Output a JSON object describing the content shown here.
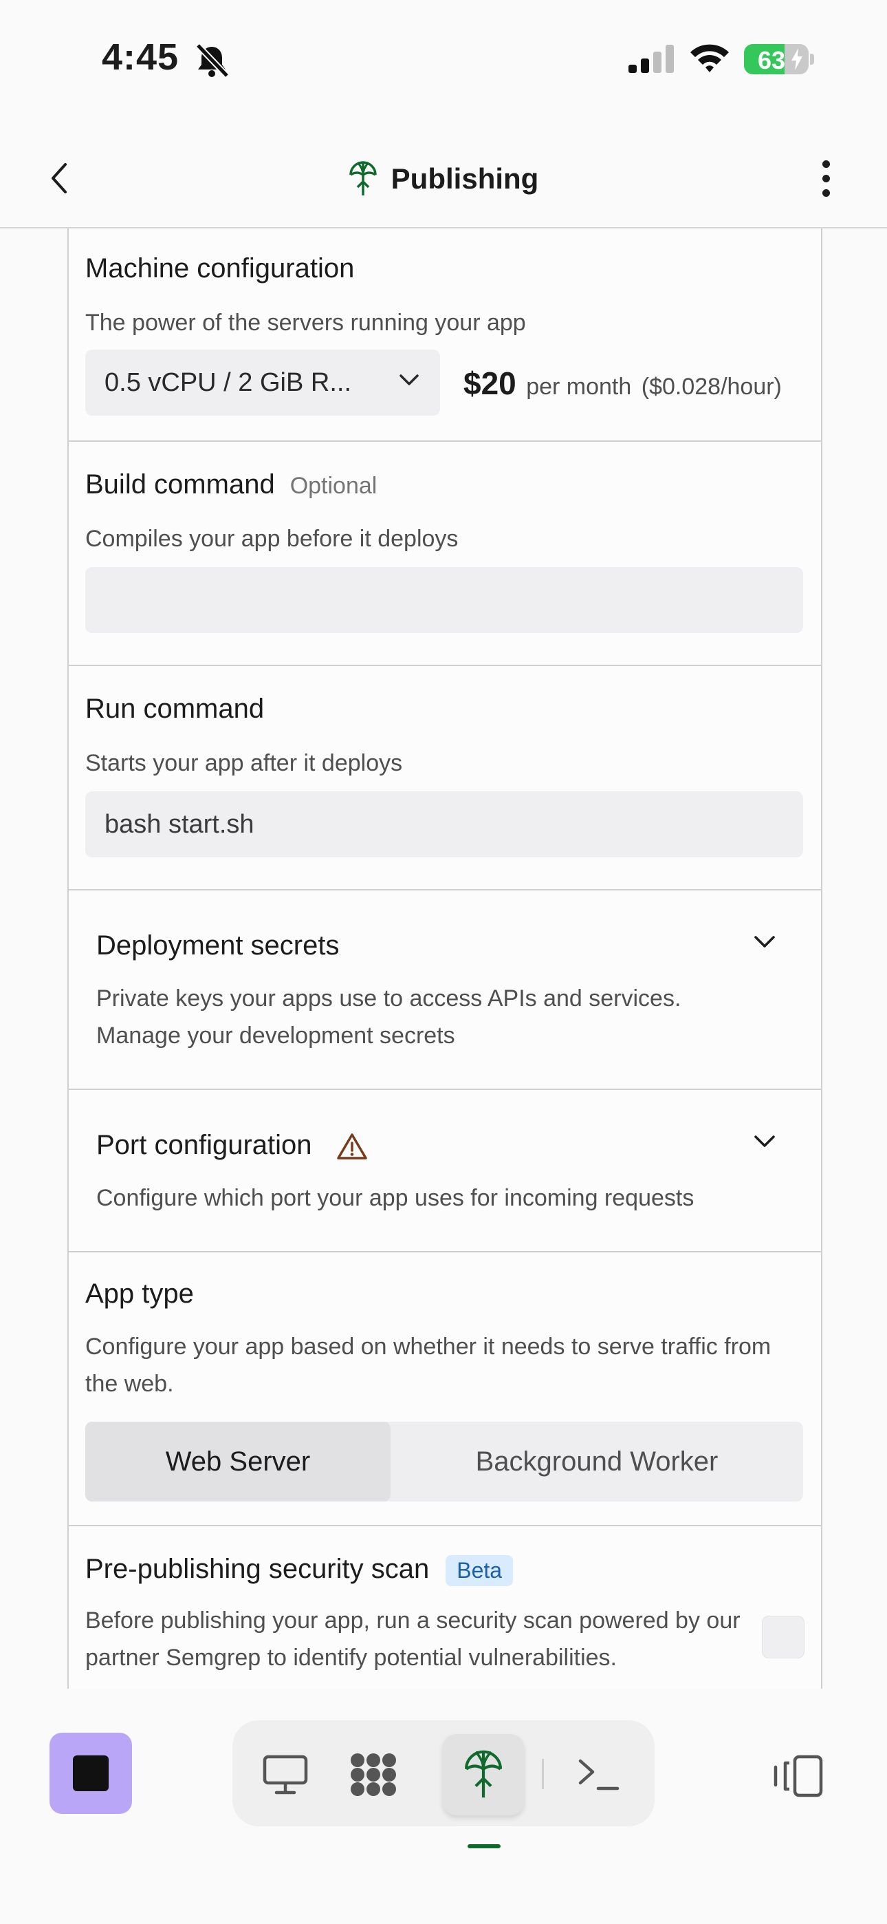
{
  "status_bar": {
    "time": "4:45",
    "battery_percent": "63",
    "battery_level": 0.63
  },
  "header": {
    "title": "Publishing"
  },
  "machine": {
    "title": "Machine configuration",
    "description": "The power of the servers running your app",
    "selected_option": "0.5 vCPU / 2 GiB R...",
    "price": "$20",
    "price_period": "per month",
    "hourly": "($0.028/hour)"
  },
  "build": {
    "title": "Build command",
    "optional_label": "Optional",
    "description": "Compiles your app before it deploys",
    "value": ""
  },
  "run": {
    "title": "Run command",
    "description": "Starts your app after it deploys",
    "value": "bash start.sh"
  },
  "secrets": {
    "title": "Deployment secrets",
    "description": "Private keys your apps use to access APIs and services.",
    "link": "Manage your development secrets"
  },
  "port": {
    "title": "Port configuration",
    "description": "Configure which port your app uses for incoming requests"
  },
  "app_type": {
    "title": "App type",
    "description": "Configure your app based on whether it needs to serve traffic from the web.",
    "options": [
      "Web Server",
      "Background Worker"
    ],
    "selected": "Web Server"
  },
  "security_scan": {
    "title": "Pre-publishing security scan",
    "badge": "Beta",
    "description": "Before publishing your app, run a security scan powered by our partner Semgrep to identify potential vulnerabilities.",
    "checked": false
  },
  "bottom_bar": {
    "tabs": [
      "preview-icon",
      "workspace-icon",
      "publishing-icon",
      "console-icon"
    ],
    "active_tab": "publishing-icon"
  },
  "colors": {
    "accent_green": "#0f6b2c",
    "stop_button": "#b9a6f7",
    "beta_badge_bg": "#d9ecff",
    "battery_green": "#34c759"
  }
}
